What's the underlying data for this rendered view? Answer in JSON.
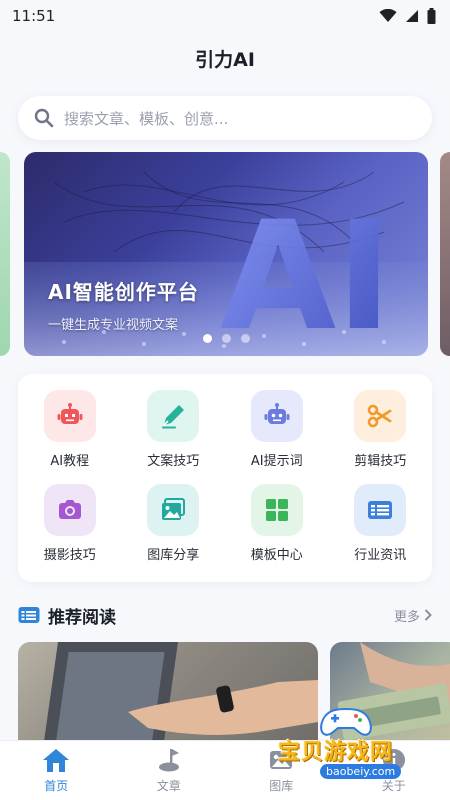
{
  "status": {
    "time": "11:51"
  },
  "header": {
    "title": "引力AI"
  },
  "search": {
    "placeholder": "搜索文章、模板、创意..."
  },
  "banner": {
    "title": "AI智能创作平台",
    "subtitle": "一键生成专业视频文案",
    "art_text": "AI",
    "slide_count": 3,
    "active_slide": 1
  },
  "tools": [
    {
      "label": "AI教程",
      "icon": "robot-icon",
      "bg": "#fde7e7",
      "color": "#f0565a"
    },
    {
      "label": "文案技巧",
      "icon": "pen-icon",
      "bg": "#dff5f0",
      "color": "#27b39a"
    },
    {
      "label": "AI提示词",
      "icon": "robot-icon",
      "bg": "#e6e9fb",
      "color": "#6b7be0"
    },
    {
      "label": "剪辑技巧",
      "icon": "scissors-icon",
      "bg": "#fdeedd",
      "color": "#f29a2e"
    },
    {
      "label": "摄影技巧",
      "icon": "camera-icon",
      "bg": "#f0e4f7",
      "color": "#a557cf"
    },
    {
      "label": "图库分享",
      "icon": "gallery-icon",
      "bg": "#dcf3f1",
      "color": "#21a99f"
    },
    {
      "label": "模板中心",
      "icon": "grid-icon",
      "bg": "#e2f5e6",
      "color": "#3cb55a"
    },
    {
      "label": "行业资讯",
      "icon": "news-icon",
      "bg": "#e1ecfb",
      "color": "#3c7fdc"
    }
  ],
  "section": {
    "title": "推荐阅读",
    "more": "更多"
  },
  "tabs": [
    {
      "label": "首页",
      "icon": "home-icon",
      "active": true
    },
    {
      "label": "文章",
      "icon": "article-icon",
      "active": false
    },
    {
      "label": "图库",
      "icon": "gallery-icon",
      "active": false
    },
    {
      "label": "关于",
      "icon": "about-icon",
      "active": false
    }
  ],
  "watermark": {
    "text": "宝贝游戏网",
    "url": "baobeiy.com"
  },
  "colors": {
    "accent": "#2f86d9",
    "page_bg": "#f6f8fc"
  }
}
